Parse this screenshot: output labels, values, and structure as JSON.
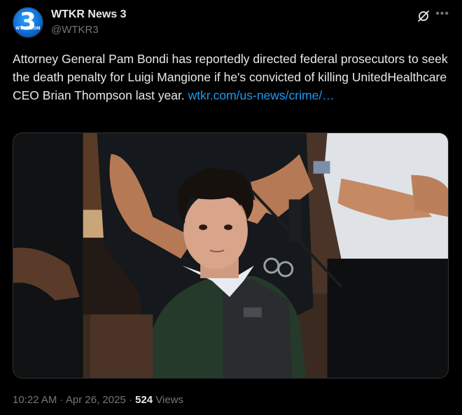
{
  "author": {
    "display_name": "WTKR News 3",
    "handle": "@WTKR3",
    "avatar_number": "3",
    "avatar_subtext": "WTKR.COM"
  },
  "tweet": {
    "text_parts": {
      "main": "Attorney General Pam Bondi has reportedly directed federal prosecutors to seek the death penalty for Luigi Mangione if he's convicted of killing UnitedHealthcare CEO Brian Thompson last year. ",
      "link": "wtkr.com/us-news/crime/…"
    },
    "timestamp": "10:22 AM · Apr 26, 2025",
    "separator": " · ",
    "views_count": "524",
    "views_label": "Views"
  },
  "icons": {
    "grok": "grok-icon",
    "more": "more-icon"
  },
  "colors": {
    "background": "#000000",
    "text": "#e7e9ea",
    "secondary": "#71767b",
    "link": "#1d9bf0"
  }
}
